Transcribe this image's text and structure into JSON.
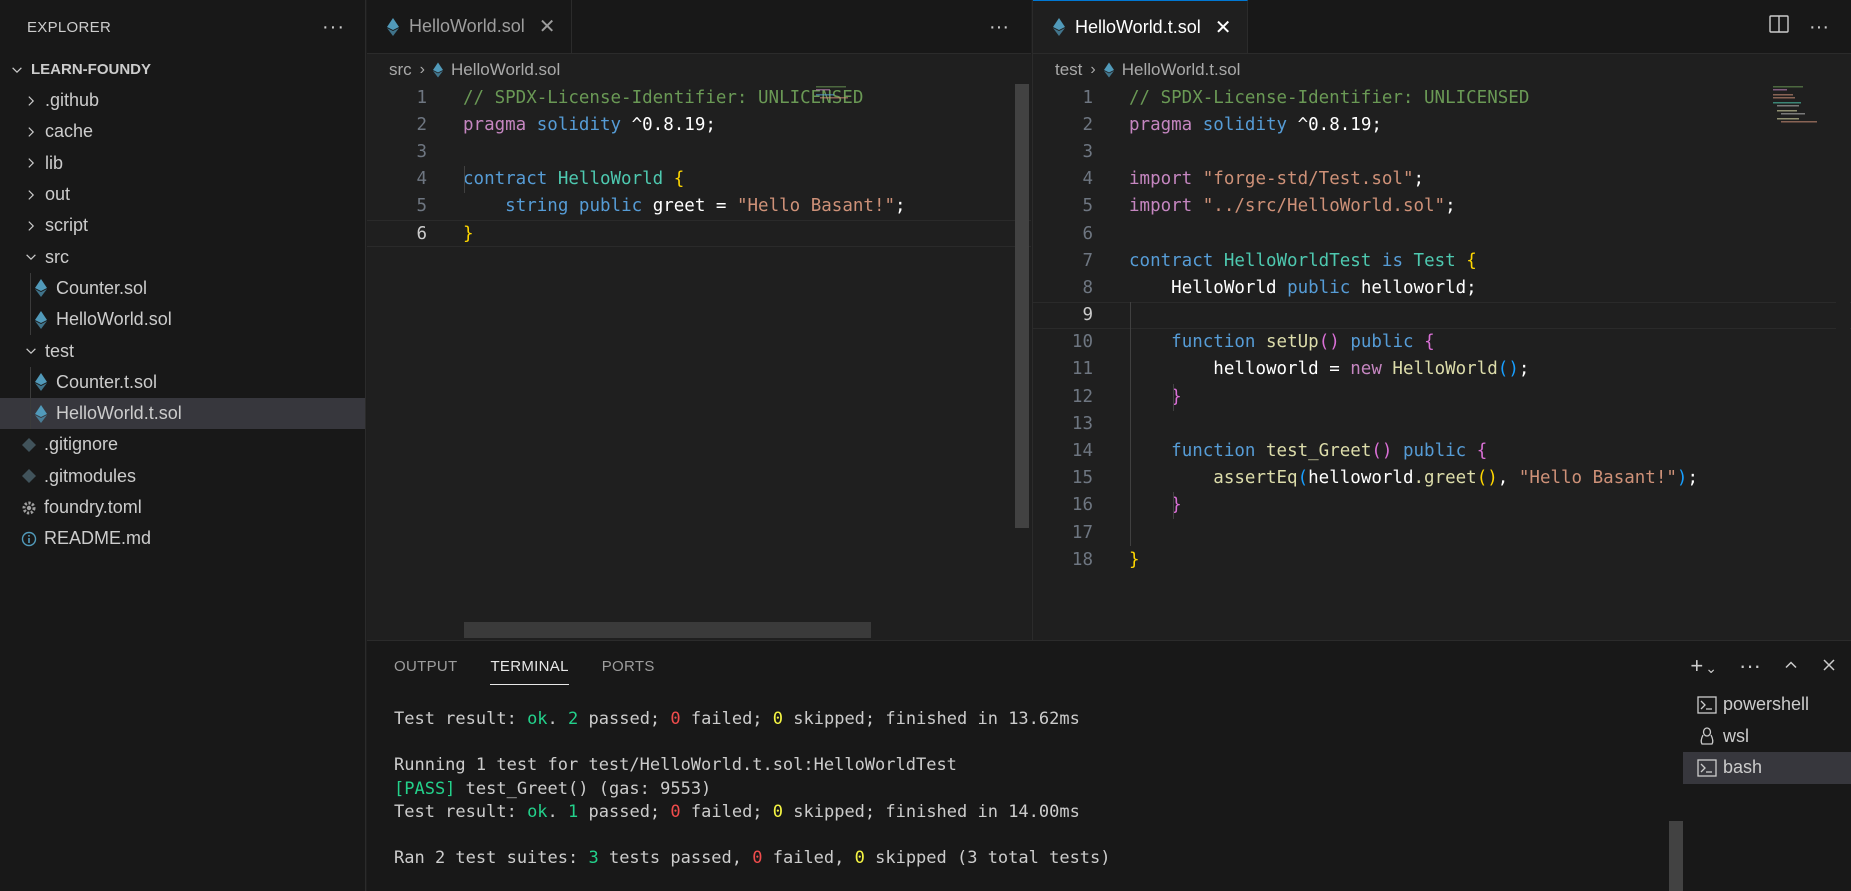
{
  "sidebar": {
    "title": "EXPLORER",
    "more": "···",
    "root": "LEARN-FOUNDY",
    "items": [
      {
        "label": ".github",
        "type": "folder"
      },
      {
        "label": "cache",
        "type": "folder"
      },
      {
        "label": "lib",
        "type": "folder"
      },
      {
        "label": "out",
        "type": "folder"
      },
      {
        "label": "script",
        "type": "folder"
      },
      {
        "label": "src",
        "type": "folder-open"
      },
      {
        "label": "Counter.sol",
        "type": "sol"
      },
      {
        "label": "HelloWorld.sol",
        "type": "sol"
      },
      {
        "label": "test",
        "type": "folder-open"
      },
      {
        "label": "Counter.t.sol",
        "type": "sol"
      },
      {
        "label": "HelloWorld.t.sol",
        "type": "sol",
        "selected": true
      },
      {
        "label": ".gitignore",
        "type": "git"
      },
      {
        "label": ".gitmodules",
        "type": "git"
      },
      {
        "label": "foundry.toml",
        "type": "gear"
      },
      {
        "label": "README.md",
        "type": "info"
      }
    ]
  },
  "editor1": {
    "tab_label": "HelloWorld.sol",
    "more": "···",
    "breadcrumb_folder": "src",
    "breadcrumb_file": "HelloWorld.sol",
    "line_numbers": [
      "1",
      "2",
      "3",
      "4",
      "5",
      "6"
    ]
  },
  "editor2": {
    "tab_label": "HelloWorld.t.sol",
    "breadcrumb_folder": "test",
    "breadcrumb_file": "HelloWorld.t.sol",
    "line_numbers": [
      "1",
      "2",
      "3",
      "4",
      "5",
      "6",
      "7",
      "8",
      "9",
      "10",
      "11",
      "12",
      "13",
      "14",
      "15",
      "16",
      "17",
      "18"
    ]
  },
  "code1": {
    "l1": "// SPDX-License-Identifier: UNLICENSED",
    "l2_kw1": "pragma",
    "l2_kw2": "solidity",
    "l2_ver": " ^0.8.19;",
    "l4_kw": "contract",
    "l4_name": "HelloWorld",
    "l5_type": "string",
    "l5_kw": "public",
    "l5_var": "greet",
    "l5_eq": " = ",
    "l5_str": "\"Hello Basant!\"",
    "l5_end": ";"
  },
  "code2": {
    "l1": "// SPDX-License-Identifier: UNLICENSED",
    "l2_kw1": "pragma",
    "l2_kw2": "solidity",
    "l2_ver": " ^0.8.19;",
    "l4_kw": "import",
    "l4_str": "\"forge-std/Test.sol\"",
    "l5_kw": "import",
    "l5_str": "\"../src/HelloWorld.sol\"",
    "l7_kw": "contract",
    "l7_name": "HelloWorldTest",
    "l7_is": "is",
    "l7_base": "Test",
    "l8_type": "HelloWorld",
    "l8_kw": "public",
    "l8_var": "helloworld;",
    "l10_kw": "function",
    "l10_fn": "setUp",
    "l10_kw2": "public",
    "l11_var": "helloworld",
    "l11_eq": " = ",
    "l11_new": "new",
    "l11_type": "HelloWorld",
    "l14_kw": "function",
    "l14_fn": "test_Greet",
    "l14_kw2": "public",
    "l15_fn": "assertEq",
    "l15_var": "helloworld",
    "l15_fn2": ".greet",
    "l15_str": "\"Hello Basant!\""
  },
  "panel": {
    "tabs": [
      "OUTPUT",
      "TERMINAL",
      "PORTS"
    ],
    "active_tab": "TERMINAL",
    "terminal_lines": {
      "r1_a": "Test result: ",
      "r1_ok": "ok",
      "r1_b": ". ",
      "r1_n1": "2",
      "r1_c": " passed; ",
      "r1_n2": "0",
      "r1_d": " failed; ",
      "r1_n3": "0",
      "r1_e": " skipped; finished in 13.62ms",
      "r2": "Running 1 test for test/HelloWorld.t.sol:HelloWorldTest",
      "r3_pass": "[PASS]",
      "r3_rest": " test_Greet() (gas: 9553)",
      "r4_a": "Test result: ",
      "r4_ok": "ok",
      "r4_b": ". ",
      "r4_n1": "1",
      "r4_c": " passed; ",
      "r4_n2": "0",
      "r4_d": " failed; ",
      "r4_n3": "0",
      "r4_e": " skipped; finished in 14.00ms",
      "r5_a": "Ran 2 test suites: ",
      "r5_n1": "3",
      "r5_b": " tests passed, ",
      "r5_n2": "0",
      "r5_c": " failed, ",
      "r5_n3": "0",
      "r5_d": " skipped (3 total tests)"
    },
    "terminals": [
      {
        "label": "powershell",
        "icon": "terminal-icon"
      },
      {
        "label": "wsl",
        "icon": "linux-icon"
      },
      {
        "label": "bash",
        "icon": "terminal-icon",
        "selected": true
      }
    ]
  },
  "colors": {
    "accent": "#0078d4",
    "solidity_icon": "#519aba",
    "pass_green": "#23d18b",
    "fail_red": "#f14c4c",
    "skip_yellow": "#f5f543"
  }
}
